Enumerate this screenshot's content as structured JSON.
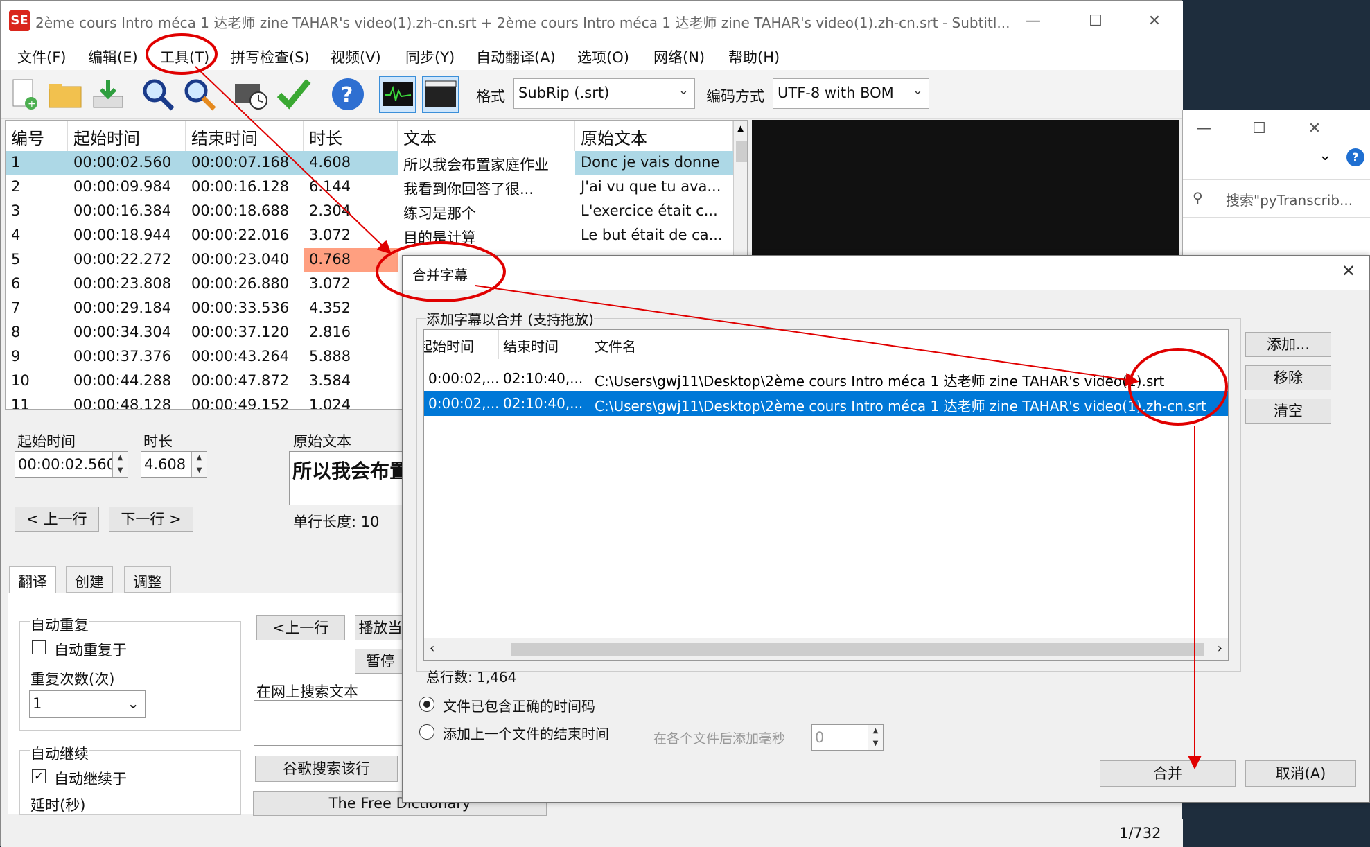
{
  "window": {
    "title": "2ème cours Intro méca 1 达老师 zine TAHAR's video(1).zh-cn.srt + 2ème cours Intro méca 1 达老师 zine TAHAR's video(1).zh-cn.srt - Subtitl...",
    "app_icon": "SE"
  },
  "menu": [
    "文件(F)",
    "编辑(E)",
    "工具(T)",
    "拼写检查(S)",
    "视频(V)",
    "同步(Y)",
    "自动翻译(A)",
    "选项(O)",
    "网络(N)",
    "帮助(H)"
  ],
  "toolbar": {
    "format_label": "格式",
    "format_value": "SubRip (.srt)",
    "encoding_label": "编码方式",
    "encoding_value": "UTF-8 with BOM"
  },
  "list": {
    "headers": [
      "编号",
      "起始时间",
      "结束时间",
      "时长",
      "文本",
      "原始文本"
    ],
    "rows": [
      [
        "1",
        "00:00:02.560",
        "00:00:07.168",
        "4.608",
        "所以我会布置家庭作业",
        "Donc je vais donne"
      ],
      [
        "2",
        "00:00:09.984",
        "00:00:16.128",
        "6.144",
        "我看到你回答了很...",
        "J'ai vu que tu ava..."
      ],
      [
        "3",
        "00:00:16.384",
        "00:00:18.688",
        "2.304",
        "练习是那个",
        "L'exercice était c..."
      ],
      [
        "4",
        "00:00:18.944",
        "00:00:22.016",
        "3.072",
        "目的是计算",
        "Le but était de ca..."
      ],
      [
        "5",
        "00:00:22.272",
        "00:00:23.040",
        "0.768",
        "",
        ""
      ],
      [
        "6",
        "00:00:23.808",
        "00:00:26.880",
        "3.072",
        "",
        ""
      ],
      [
        "7",
        "00:00:29.184",
        "00:00:33.536",
        "4.352",
        "",
        ""
      ],
      [
        "8",
        "00:00:34.304",
        "00:00:37.120",
        "2.816",
        "",
        ""
      ],
      [
        "9",
        "00:00:37.376",
        "00:00:43.264",
        "5.888",
        "",
        ""
      ],
      [
        "10",
        "00:00:44.288",
        "00:00:47.872",
        "3.584",
        "",
        ""
      ],
      [
        "11",
        "00:00:48.128",
        "00:00:49.152",
        "1.024",
        "",
        ""
      ]
    ]
  },
  "edit": {
    "start_label": "起始时间",
    "start_value": "00:00:02.560",
    "duration_label": "时长",
    "duration_value": "4.608",
    "original_label": "原始文本",
    "original_text": "所以我会布置",
    "line_length": "单行长度: 10",
    "prev_line": "< 上一行",
    "next_line": "下一行 >"
  },
  "tabs": [
    "翻译",
    "创建",
    "调整"
  ],
  "translate_panel": {
    "auto_repeat_group": "自动重复",
    "auto_repeat_check": "自动重复于",
    "repeat_count_label": "重复次数(次)",
    "repeat_count_value": "1",
    "auto_continue_group": "自动继续",
    "auto_continue_check": "自动继续于",
    "delay_label": "延时(秒)",
    "prev_btn": "<上一行",
    "play_btn": "播放当",
    "pause_btn": "暂停",
    "search_web_label": "在网上搜索文本",
    "google_btn": "谷歌搜索该行",
    "free_dict_btn": "The Free Dictionary"
  },
  "status": {
    "position": "1/732"
  },
  "bgwin": {
    "search_placeholder": "搜索\"pyTranscrib..."
  },
  "dialog": {
    "title": "合并字幕",
    "group_label": "添加字幕以合并 (支持拖放)",
    "headers": [
      "起始时间",
      "结束时间",
      "文件名"
    ],
    "rows": [
      [
        "0:00:02,...",
        "02:10:40,...",
        "C:\\Users\\gwj11\\Desktop\\2ème cours Intro méca 1 达老师 zine TAHAR's video(1).srt"
      ],
      [
        "0:00:02,...",
        "02:10:40,...",
        "C:\\Users\\gwj11\\Desktop\\2ème cours Intro méca 1 达老师 zine TAHAR's video(1).zh-cn.srt"
      ]
    ],
    "add_btn": "添加...",
    "remove_btn": "移除",
    "clear_btn": "清空",
    "total_lines": "总行数: 1,464",
    "radio1": "文件已包含正确的时间码",
    "radio2": "添加上一个文件的结束时间",
    "ms_label": "在各个文件后添加毫秒",
    "ms_value": "0",
    "merge_btn": "合并",
    "cancel_btn": "取消(A)"
  },
  "colors": {
    "selected_row": "#add8e6",
    "warning_cell": "#ff9f80",
    "dialog_selection": "#0078d7",
    "annotation": "#e00000"
  }
}
